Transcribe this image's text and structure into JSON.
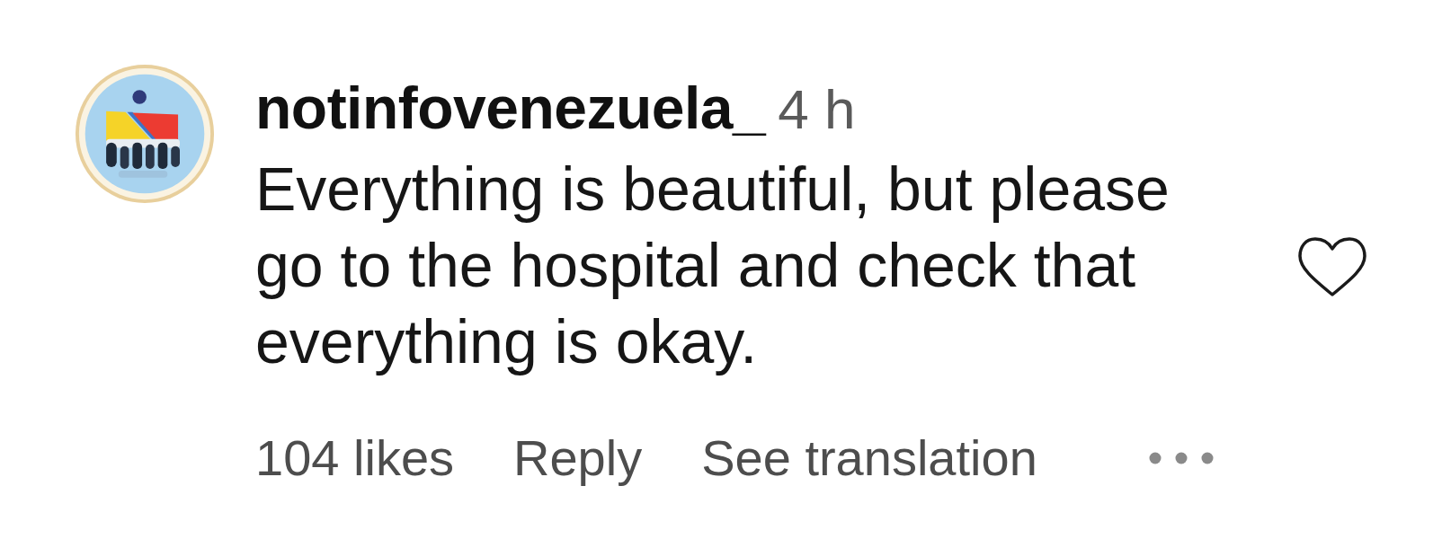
{
  "comment": {
    "username": "notinfovenezuela_",
    "time": "4 h",
    "text": "Everything is beautiful, but please go to the hospital and check that everything is okay.",
    "liked": false,
    "likes": "104 likes",
    "actions": [
      "Reply",
      "See translation"
    ]
  }
}
